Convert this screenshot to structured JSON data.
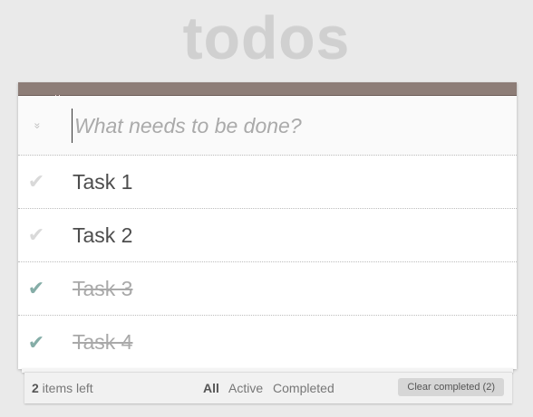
{
  "app": {
    "title": "todos"
  },
  "new_todo": {
    "placeholder": "What needs to be done?",
    "toggle_all_glyph": "»"
  },
  "todos": [
    {
      "label": "Task 1",
      "completed": false
    },
    {
      "label": "Task 2",
      "completed": false
    },
    {
      "label": "Task 3",
      "completed": true
    },
    {
      "label": "Task 4",
      "completed": true
    }
  ],
  "check_glyph": "✔",
  "footer": {
    "count": "2",
    "count_suffix": " items left",
    "filters": [
      "All",
      "Active",
      "Completed"
    ],
    "selected_filter": "All",
    "clear_label": "Clear completed (2)"
  },
  "colors": {
    "header_bar": "#8d7d77",
    "check_done": "#85ada7",
    "check_todo": "#d9d9d9",
    "margin_line": "#f5d6d6"
  }
}
